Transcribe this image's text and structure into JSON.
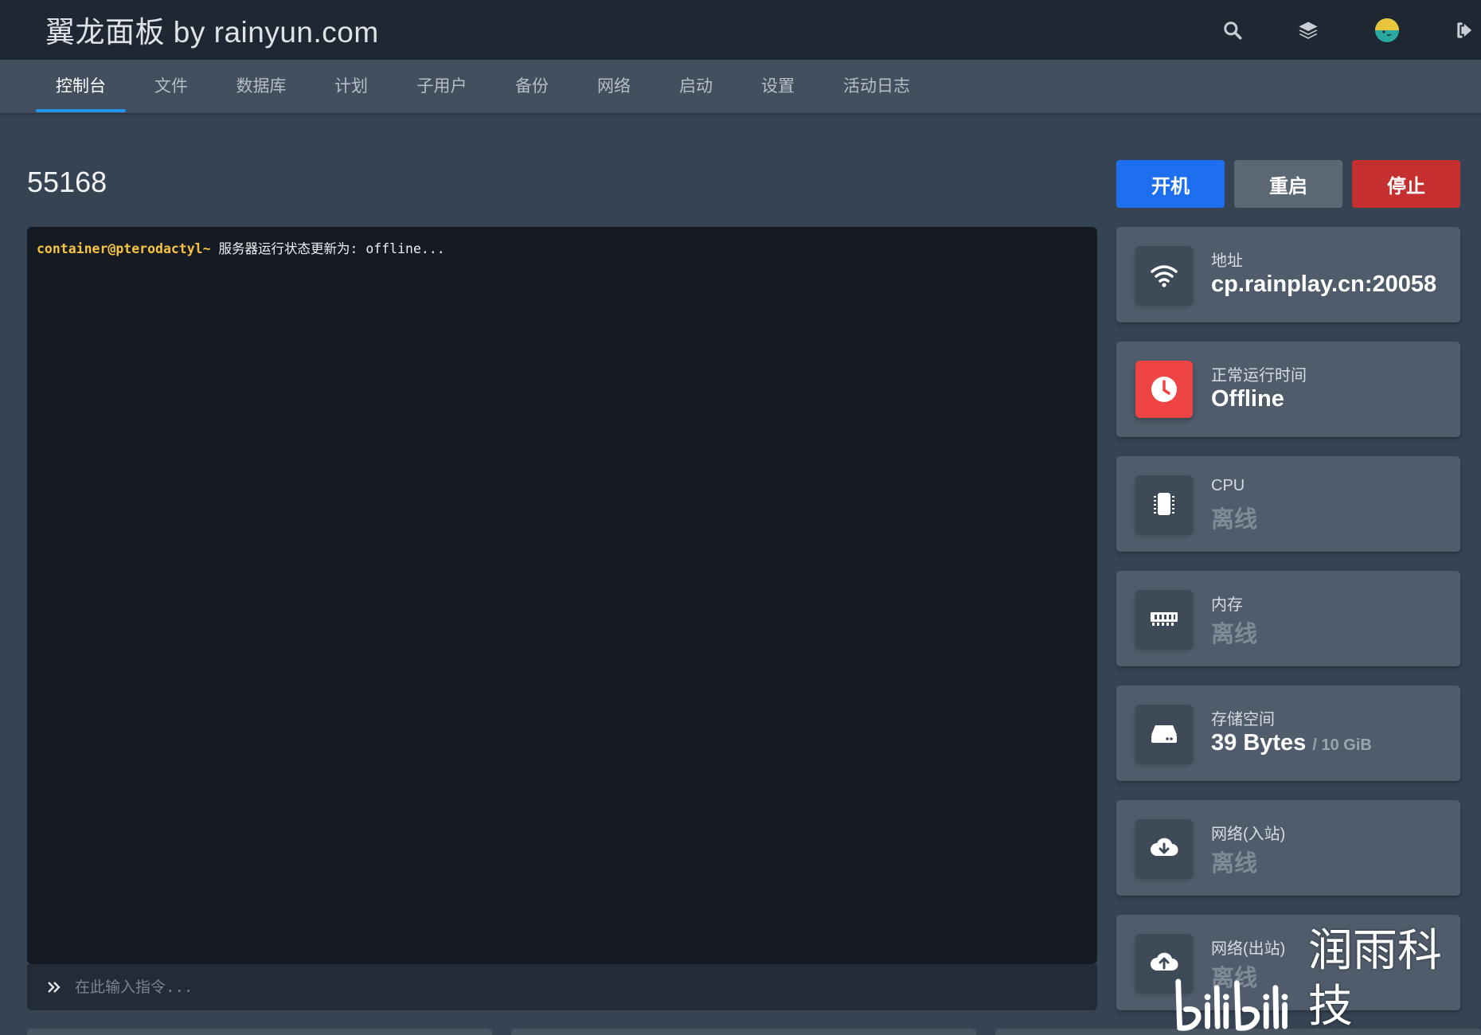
{
  "app": {
    "brand": "翼龙面板 by rainyun.com"
  },
  "nav": {
    "tabs": [
      {
        "label": "控制台",
        "active": true
      },
      {
        "label": "文件"
      },
      {
        "label": "数据库"
      },
      {
        "label": "计划"
      },
      {
        "label": "子用户"
      },
      {
        "label": "备份"
      },
      {
        "label": "网络"
      },
      {
        "label": "启动"
      },
      {
        "label": "设置"
      },
      {
        "label": "活动日志"
      }
    ]
  },
  "server": {
    "name": "55168"
  },
  "power": {
    "start_label": "开机",
    "restart_label": "重启",
    "stop_label": "停止"
  },
  "console": {
    "prompt": "container@pterodactyl~",
    "message": " 服务器运行状态更新为: offline...",
    "input_placeholder": "在此输入指令..."
  },
  "stats": {
    "address": {
      "label": "地址",
      "value": "cp.rainplay.cn:20058"
    },
    "uptime": {
      "label": "正常运行时间",
      "value": "Offline"
    },
    "cpu": {
      "label": "CPU",
      "value": "离线"
    },
    "memory": {
      "label": "内存",
      "value": "离线"
    },
    "disk": {
      "label": "存储空间",
      "value": "39 Bytes",
      "limit": "/ 10 GiB"
    },
    "net_in": {
      "label": "网络(入站)",
      "value": "离线"
    },
    "net_out": {
      "label": "网络(出站)",
      "value": "离线"
    }
  },
  "watermark": {
    "logo": "bilibili",
    "text": "润雨科技"
  },
  "colors": {
    "accent": "#2196f3",
    "start": "#1e6ff0",
    "restart": "#5c6774",
    "stop": "#c62f2f",
    "danger": "#ef4444",
    "prompt": "#f6c343"
  },
  "icons": {
    "top": [
      "search-icon",
      "layers-icon",
      "avatar",
      "logout-icon"
    ],
    "stats": [
      "wifi-icon",
      "clock-icon",
      "cpu-chip-icon",
      "memory-icon",
      "hard-drive-icon",
      "cloud-download-icon",
      "cloud-upload-icon"
    ]
  }
}
